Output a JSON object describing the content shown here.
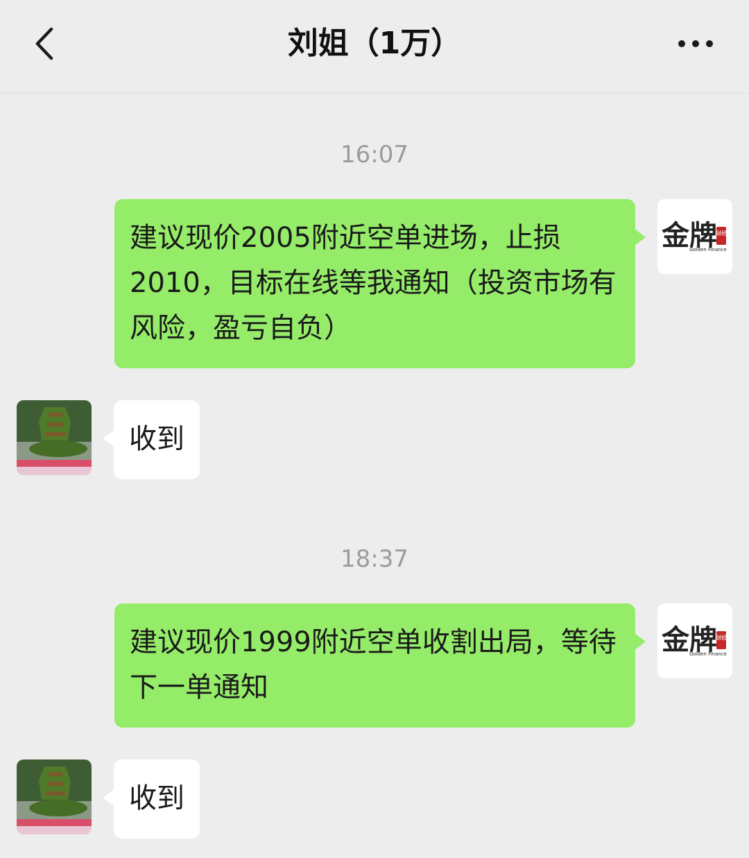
{
  "header": {
    "title": "刘姐（1万）",
    "back_icon": "chevron-left-icon",
    "more_icon": "more-dots-icon"
  },
  "messages": [
    {
      "type": "time",
      "text": "16:07"
    },
    {
      "type": "outgoing",
      "text": "建议现价2005附近空单进场，止损2010，目标在线等我通知（投资市场有风险，盈亏自负）",
      "avatar": {
        "logo_text": "金牌",
        "logo_subtext": "Golden Finance",
        "seal_text": "财经"
      }
    },
    {
      "type": "incoming",
      "text": "收到",
      "avatar": "topiary-sailboat-photo"
    },
    {
      "type": "time",
      "text": "18:37"
    },
    {
      "type": "outgoing",
      "text": "建议现价1999附近空单收割出局，等待下一单通知",
      "avatar": {
        "logo_text": "金牌",
        "logo_subtext": "Golden Finance",
        "seal_text": "财经"
      }
    },
    {
      "type": "incoming",
      "text": "收到",
      "avatar": "topiary-sailboat-photo"
    }
  ],
  "colors": {
    "background": "#ededed",
    "outgoing_bubble": "#95ec69",
    "incoming_bubble": "#ffffff",
    "timestamp": "#9b9b9b"
  }
}
